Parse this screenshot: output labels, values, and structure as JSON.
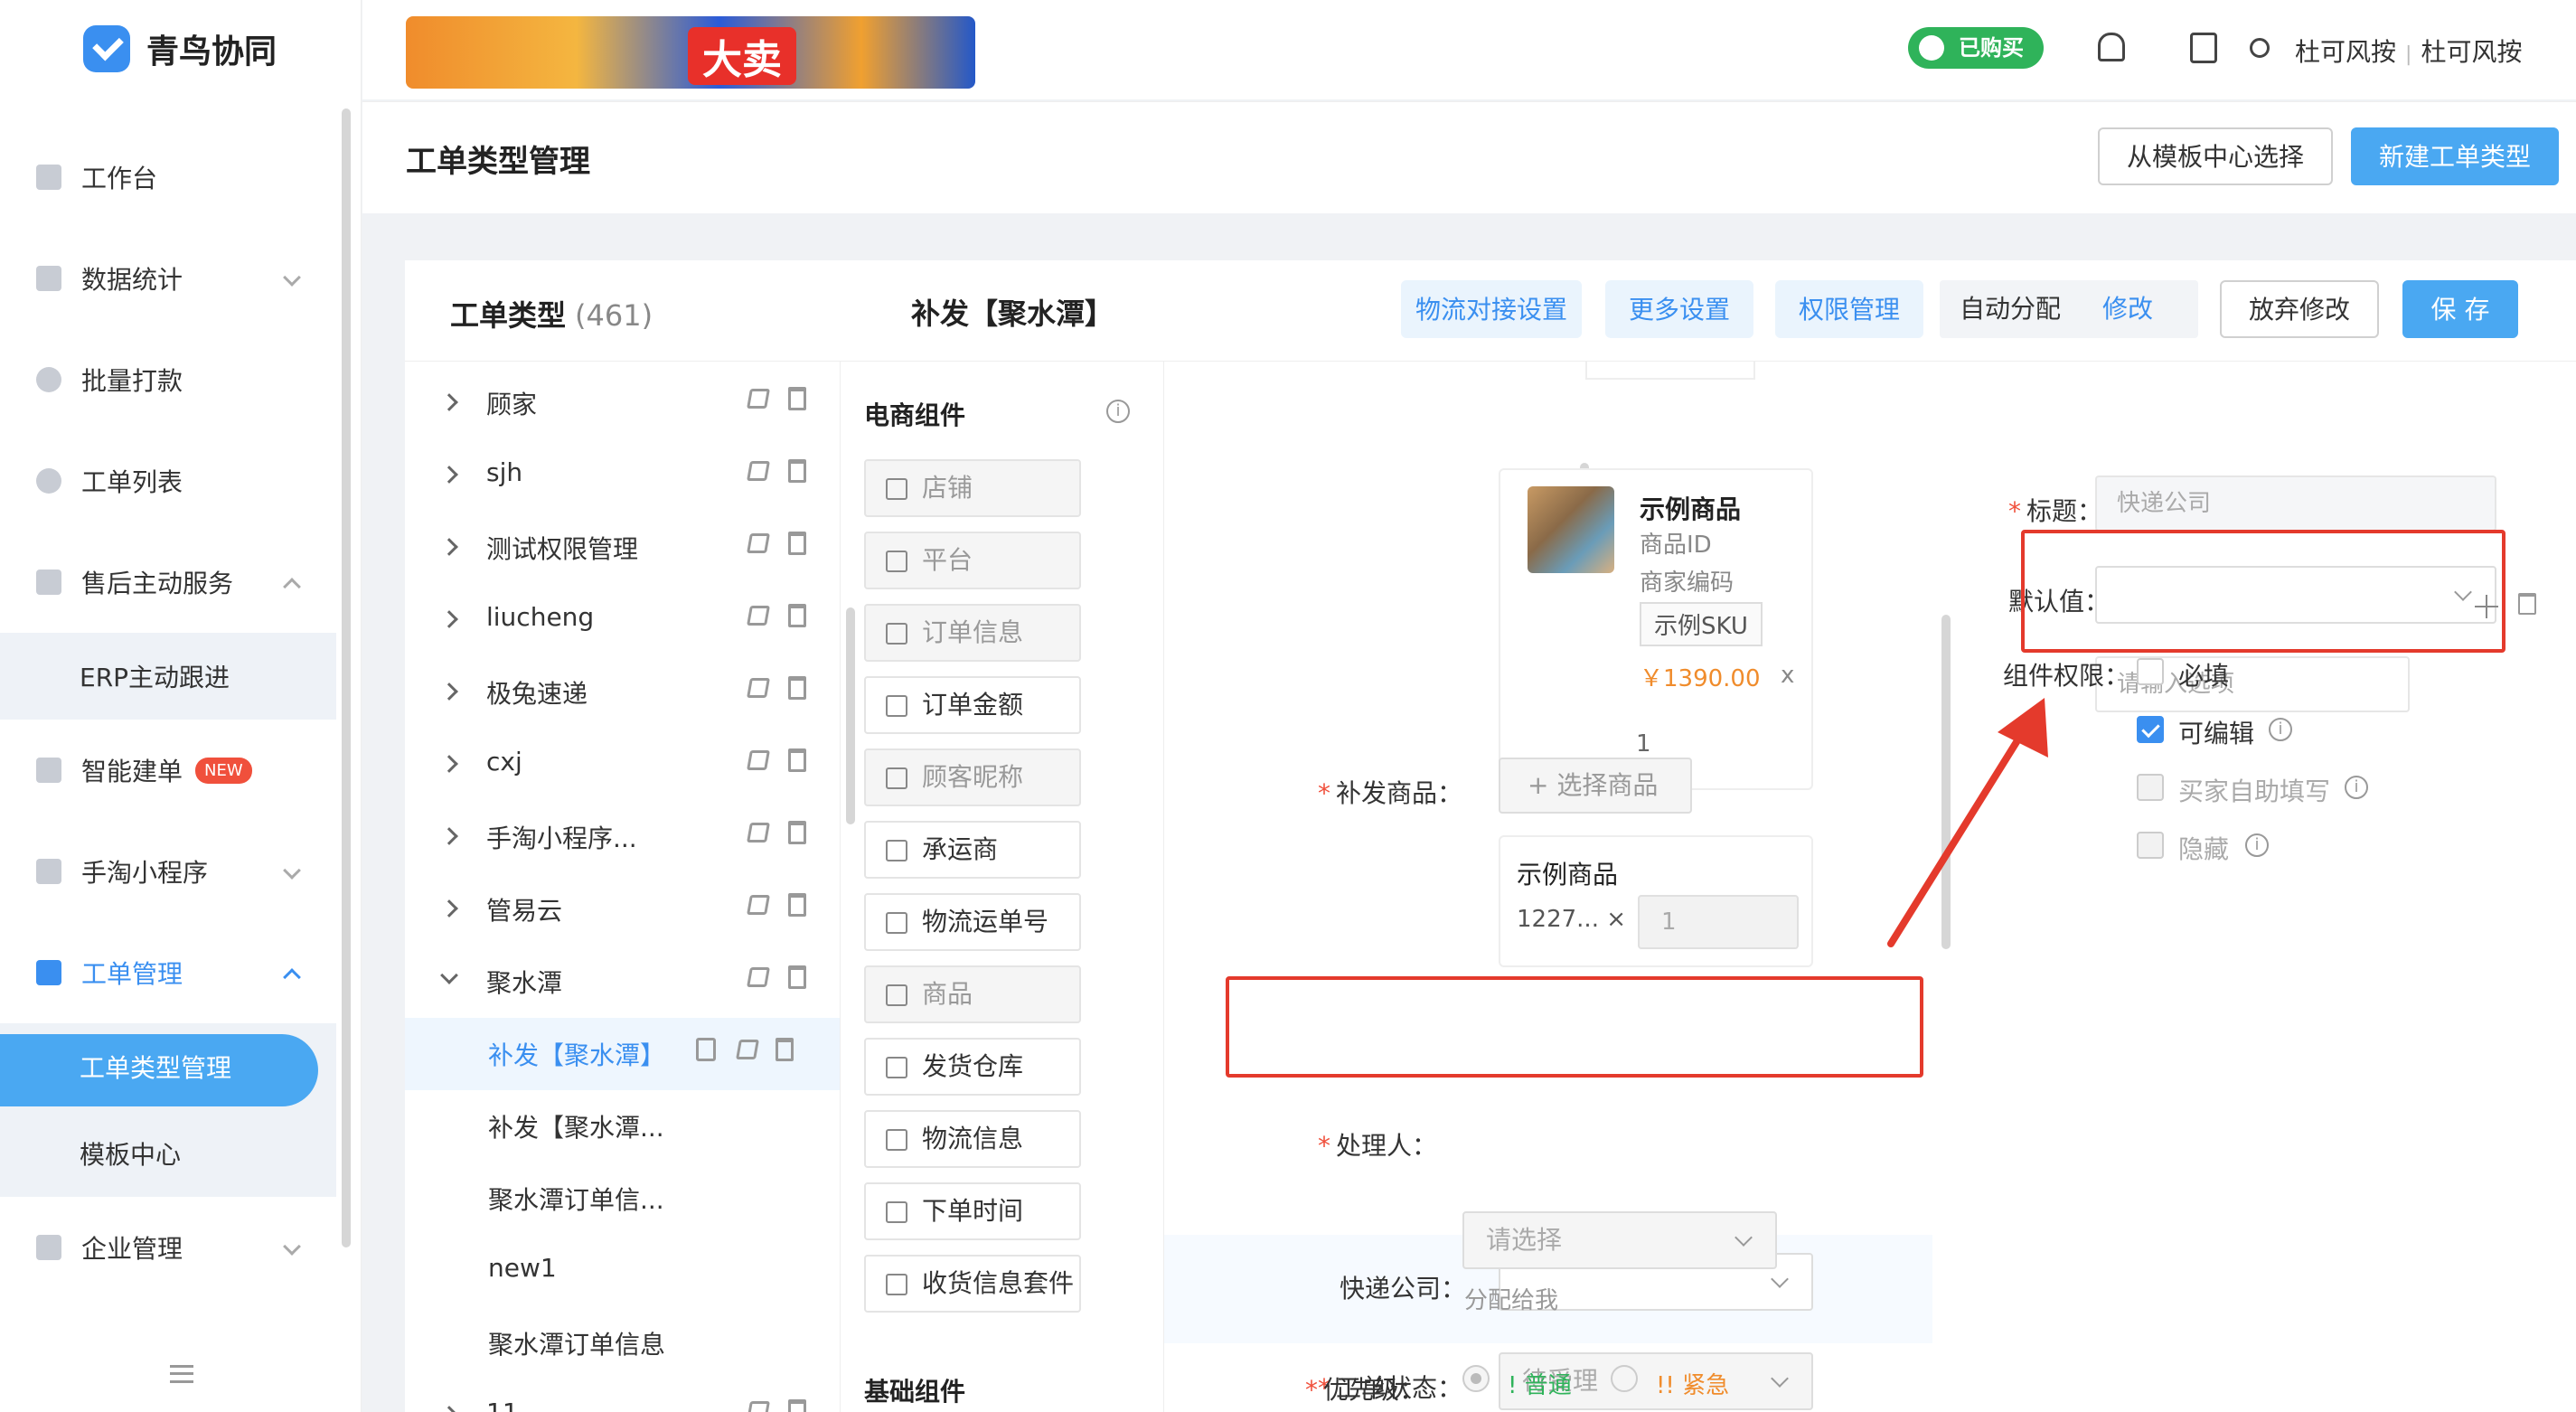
{
  "app": {
    "name": "青鸟协同"
  },
  "topbar": {
    "banner_text": "大卖",
    "bought_badge": "已购买",
    "user": "杜可风按",
    "tenant": "杜可风按"
  },
  "sidebar": {
    "items": [
      {
        "label": "工作台"
      },
      {
        "label": "数据统计"
      },
      {
        "label": "批量打款"
      },
      {
        "label": "工单列表"
      },
      {
        "label": "售后主动服务"
      },
      {
        "label": "ERP主动跟进"
      },
      {
        "label": "智能建单",
        "badge": "NEW"
      },
      {
        "label": "手淘小程序"
      },
      {
        "label": "工单管理"
      },
      {
        "label": "工单类型管理"
      },
      {
        "label": "模板中心"
      },
      {
        "label": "企业管理"
      }
    ]
  },
  "page": {
    "title": "工单类型管理",
    "btn_template": "从模板中心选择",
    "btn_new": "新建工单类型"
  },
  "types": {
    "title": "工单类型",
    "count": "(461)",
    "rows": [
      {
        "name": "顾家"
      },
      {
        "name": "sjh"
      },
      {
        "name": "测试权限管理"
      },
      {
        "name": "liucheng"
      },
      {
        "name": "极兔速递"
      },
      {
        "name": "cxj"
      },
      {
        "name": "手淘小程序..."
      },
      {
        "name": "管易云"
      },
      {
        "name": "聚水潭"
      },
      {
        "name": "补发【聚水潭】"
      },
      {
        "name": "补发【聚水潭..."
      },
      {
        "name": "聚水潭订单信..."
      },
      {
        "name": "new1"
      },
      {
        "name": "聚水潭订单信息"
      },
      {
        "name": "11"
      }
    ]
  },
  "editor": {
    "title": "补发【聚水潭】",
    "tab_logistics": "物流对接设置",
    "tab_more": "更多设置",
    "tab_perm": "权限管理",
    "auto_assign": "自动分配",
    "auto_edit": "修改",
    "btn_discard": "放弃修改",
    "btn_save": "保 存"
  },
  "palette": {
    "title": "电商组件",
    "title_basic": "基础组件",
    "items": [
      "店铺",
      "平台",
      "订单信息",
      "订单金额",
      "顾客昵称",
      "承运商",
      "物流运单号",
      "商品",
      "发货仓库",
      "物流信息",
      "下单时间",
      "收货信息套件"
    ]
  },
  "preview": {
    "product": {
      "name": "示例商品",
      "id_label": "商品ID",
      "code_label": "商家编码",
      "sku": "示例SKU",
      "price": "￥1390.00",
      "x": "x",
      "qty": "1"
    },
    "reissue_label": "补发商品：",
    "select_product": "+ 选择商品",
    "item_name": "示例商品",
    "item_id": "1227...",
    "item_close": "×",
    "item_qty": "1",
    "courier_label": "快递公司：",
    "status_label": "工单状态：",
    "status_value": "待受理",
    "handler_label": "处理人：",
    "handler_placeholder": "请选择",
    "assign_me": "分配给我",
    "priority_label": "优先级：",
    "priority_normal": "! 普通",
    "priority_urgent": "!! 紧急"
  },
  "props": {
    "title_label": "标题：",
    "title_value": "快递公司",
    "default_label": "默认值：",
    "option_placeholder": "请输入选项",
    "perm_label": "组件权限：",
    "required": "必填",
    "editable": "可编辑",
    "buyer_fill": "买家自助填写",
    "hidden": "隐藏"
  },
  "colors": {
    "accent": "#3a8ff0",
    "primary_btn": "#4aa8f2",
    "highlight_red": "#e43a2c",
    "success": "#2fb35a",
    "warning": "#f08c2c"
  }
}
